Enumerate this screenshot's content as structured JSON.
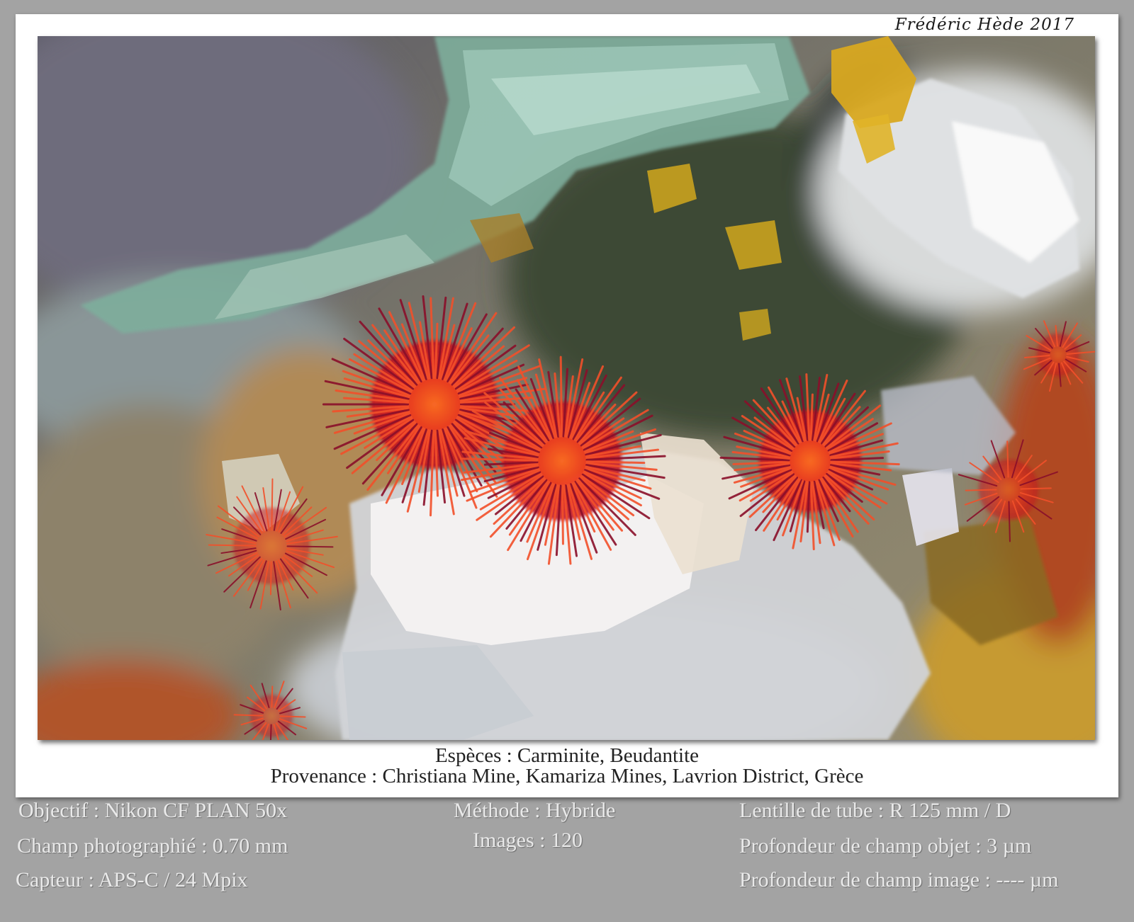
{
  "signature": "Frédéric Hède 2017",
  "caption": {
    "species": "Espèces : Carminite, Beudantite",
    "origin": "Provenance : Christiana Mine, Kamariza Mines, Lavrion District,  Grèce"
  },
  "specs": {
    "objective": "Objectif : Nikon CF PLAN 50x",
    "field": "Champ photographié : 0.70 mm",
    "sensor": "Capteur : APS-C / 24 Mpix",
    "method": "Méthode : Hybride",
    "images": "Images : 120",
    "tube_lens": "Lentille de tube : R 125 mm / D",
    "depth_object": "Profondeur de champ objet : 3 µm",
    "depth_image": "Profondeur de champ image : ---- µm"
  },
  "colors": {
    "background": "#a3a3a3",
    "frame": "#ffffff",
    "carminite": "#e8281a",
    "beudantite": "#c9a21e",
    "info_text": "#e9e9e9"
  }
}
